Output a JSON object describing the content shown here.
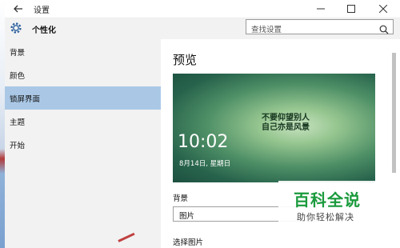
{
  "window": {
    "title": "设置"
  },
  "header": {
    "section_title": "个性化",
    "search_placeholder": "查找设置"
  },
  "sidebar": {
    "items": [
      {
        "label": "背景"
      },
      {
        "label": "颜色"
      },
      {
        "label": "锁屏界面",
        "active": true
      },
      {
        "label": "主题"
      },
      {
        "label": "开始"
      }
    ]
  },
  "content": {
    "heading": "预览",
    "preview": {
      "slogan_line1": "不要仰望别人",
      "slogan_line2": "自己亦是风景",
      "time": "10:02",
      "date": "8月14日, 星期日"
    },
    "background_label": "背景",
    "background_value": "图片",
    "choose_label": "选择图片"
  },
  "watermark": {
    "title": "百科全说",
    "subtitle": "助你轻松解决"
  },
  "colors": {
    "active_nav": "#aac8e6",
    "watermark_green": "#1a9a3c"
  }
}
